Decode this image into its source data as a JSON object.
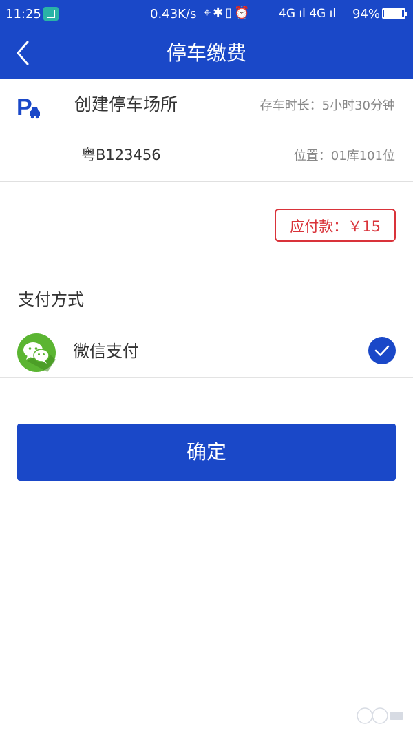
{
  "status_bar": {
    "time": "11:25",
    "speed": "0.43K/s",
    "network": "4G ıl 4G ıl",
    "battery": "94%"
  },
  "header": {
    "title": "停车缴费"
  },
  "parking": {
    "lot_name": "创建停车场所",
    "duration_label": "存车时长：",
    "duration_value": "5小时30分钟",
    "plate": "粤B123456",
    "position_label": "位置：",
    "position_value": "01库101位"
  },
  "amount": {
    "text": "应付款：￥15"
  },
  "payment": {
    "section_title": "支付方式",
    "method_label": "微信支付",
    "selected": true
  },
  "actions": {
    "confirm_label": "确定"
  },
  "colors": {
    "primary": "#1a48c8",
    "amount_red": "#d9333a",
    "wechat_green": "#5bb532"
  }
}
